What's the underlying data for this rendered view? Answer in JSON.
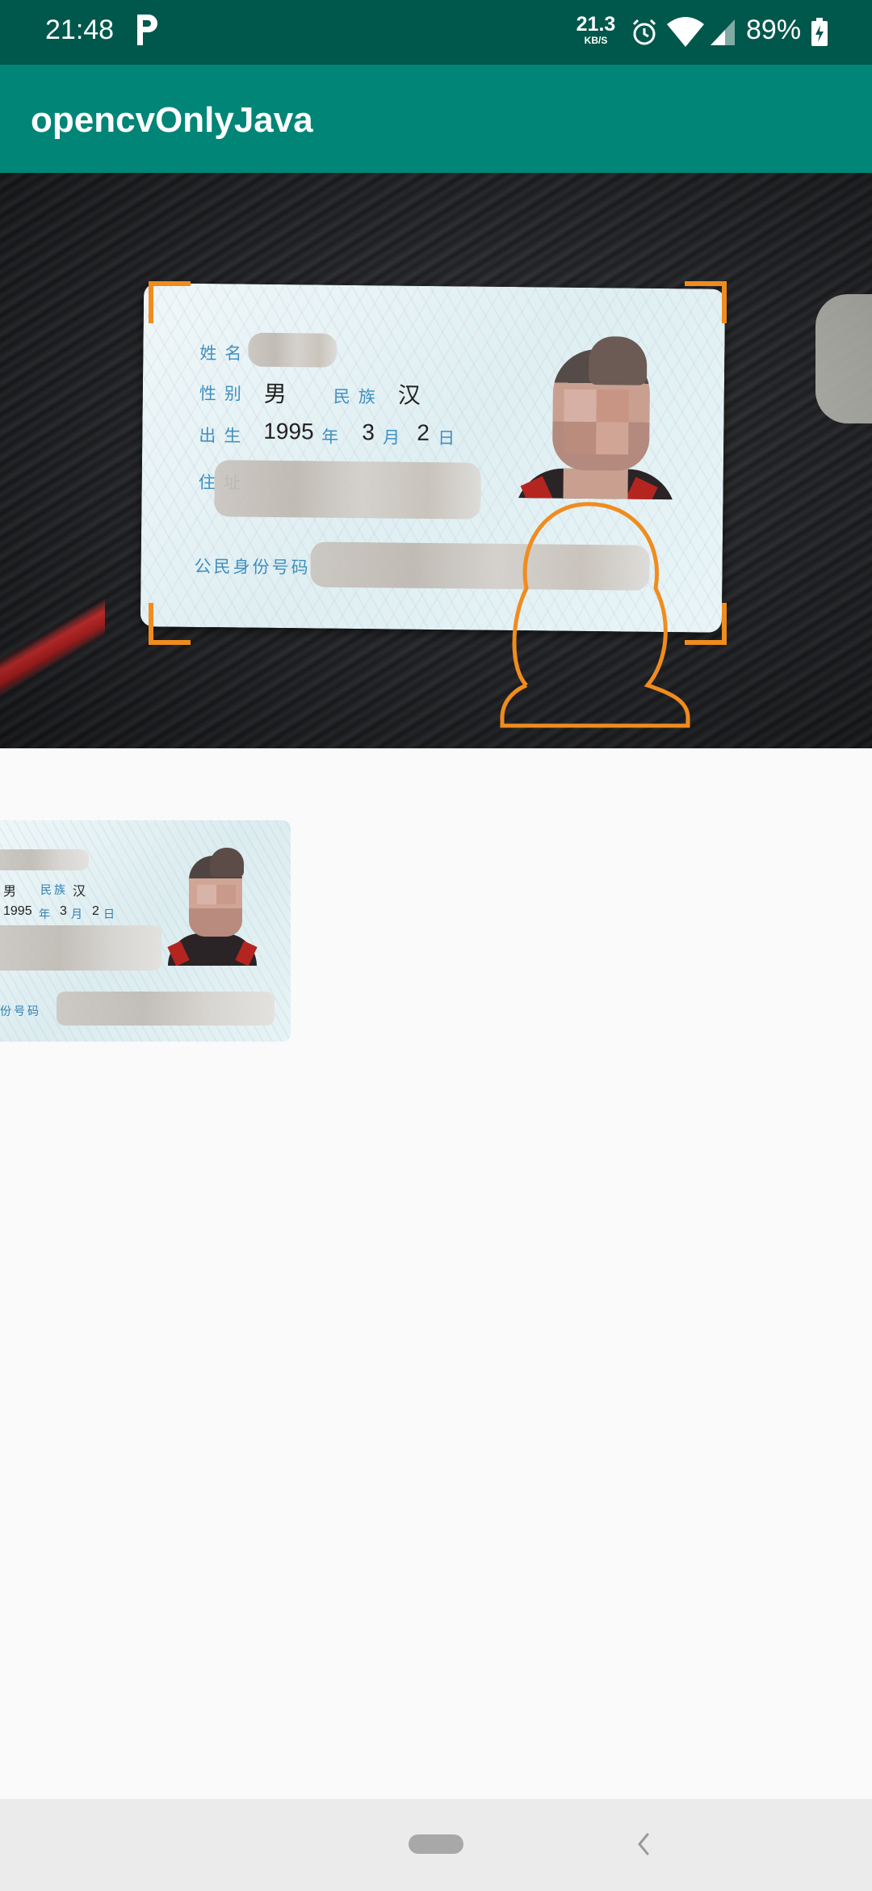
{
  "status_bar": {
    "time": "21:48",
    "notification_icon": "parking-p-icon",
    "net_speed_value": "21.3",
    "net_speed_unit": "KB/S",
    "battery_percent": "89%",
    "icons": [
      "alarm-icon",
      "wifi-icon",
      "cell-signal-icon",
      "battery-charging-icon"
    ]
  },
  "app_bar": {
    "title": "opencvOnlyJava",
    "color": "#008577",
    "status_color": "#00574b"
  },
  "camera_preview": {
    "card": {
      "name_label": "姓名",
      "sex_label": "性别",
      "sex_value": "男",
      "ethnicity_label": "民族",
      "ethnicity_value": "汉",
      "birth_label": "出生",
      "birth_year": "1995",
      "birth_year_unit": "年",
      "birth_month": "3",
      "birth_month_unit": "月",
      "birth_day": "2",
      "birth_day_unit": "日",
      "address_label": "住址",
      "id_label": "公民身份号码"
    },
    "overlay_color": "#f08c1e"
  },
  "cropped_result": {
    "sex_value": "男",
    "ethnicity_label": "民族",
    "ethnicity_value": "汉",
    "birth_year": "1995",
    "birth_year_unit": "年",
    "birth_month": "3",
    "birth_month_unit": "月",
    "birth_day": "2",
    "birth_day_unit": "日",
    "id_label_partial": "份号码"
  },
  "nav_bar": {
    "icons": [
      "home-pill-icon",
      "back-chevron-icon"
    ]
  }
}
